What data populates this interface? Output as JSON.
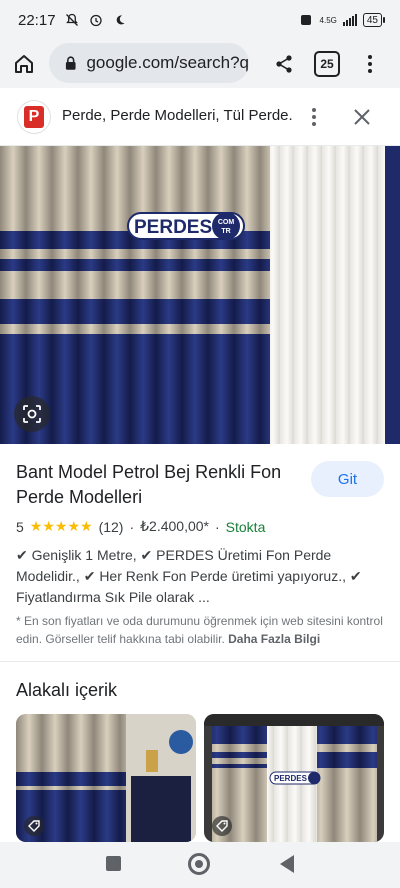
{
  "status_bar": {
    "time": "22:17",
    "icons": [
      "mute-icon",
      "alarm-icon",
      "moon-icon"
    ],
    "network": "4.5G",
    "battery": "45"
  },
  "browser": {
    "url": "google.com/search?q",
    "tab_count": "25",
    "icons": [
      "home-icon",
      "lock-icon",
      "share-icon",
      "more-vert-icon"
    ]
  },
  "site_header": {
    "favicon_letter": "P",
    "title": "Perde, Perde Modelleri, Tül Perde..."
  },
  "hero": {
    "logo_text": "PERDES",
    "logo_badge_top": "COM",
    "logo_badge_bottom": "TR"
  },
  "product": {
    "title": "Bant Model Petrol Bej Renkli Fon Perde Modelleri",
    "action_label": "Git",
    "rating": "5",
    "stars": "★★★★★",
    "review_count": "(12)",
    "separator": "·",
    "price": "₺2.400,00*",
    "availability": "Stokta",
    "description": "✔ Genişlik 1 Metre, ✔ PERDES Üretimi Fon Perde Modelidir., ✔ Her Renk Fon Perde üretimi yapıyoruz., ✔ Fiyatlandırma Sık Pile olarak ...",
    "footnote": "* En son fiyatları ve oda durumunu öğrenmek için web sitesini kontrol edin. Görseller telif hakkına tabi olabilir.",
    "more_info": "Daha Fazla Bilgi"
  },
  "related": {
    "title": "Alakalı içerik",
    "card_logo": "PERDES",
    "card_badge": "COM TR"
  },
  "colors": {
    "navy": "#1f2a6b",
    "beige": "#c9c0ad",
    "link_blue": "#1a73e8",
    "stock_green": "#188038",
    "star_yellow": "#fbbc04"
  }
}
